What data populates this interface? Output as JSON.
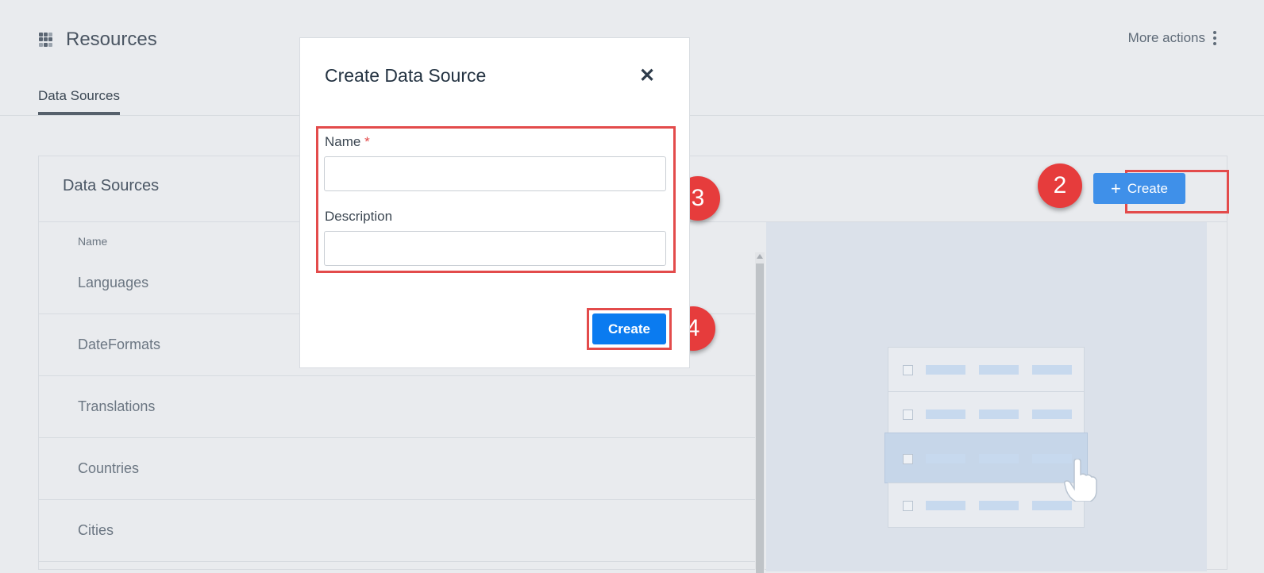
{
  "header": {
    "title": "Resources",
    "app_icon": "apps-grid-icon",
    "more_actions_label": "More actions",
    "more_actions_icon": "kebab-menu-icon",
    "tabs": [
      {
        "label": "Data Sources",
        "active": true
      }
    ]
  },
  "panel": {
    "title": "Data Sources",
    "create_label": "Create",
    "create_icon": "plus-icon",
    "column_name": "Name",
    "rows": [
      "Languages",
      "DateFormats",
      "Translations",
      "Countries",
      "Cities"
    ]
  },
  "modal": {
    "title": "Create Data Source",
    "close_icon": "close-icon",
    "name_label": "Name",
    "required_mark": "*",
    "name_value": "",
    "description_label": "Description",
    "description_value": "",
    "submit_label": "Create"
  },
  "annotations": {
    "step_2": "2",
    "step_3": "3",
    "step_4": "4",
    "highlight_color": "#e34b4b"
  },
  "colors": {
    "primary": "#0a7bf0",
    "secondary_button": "#3f90e9",
    "background": "#e9ebee"
  }
}
